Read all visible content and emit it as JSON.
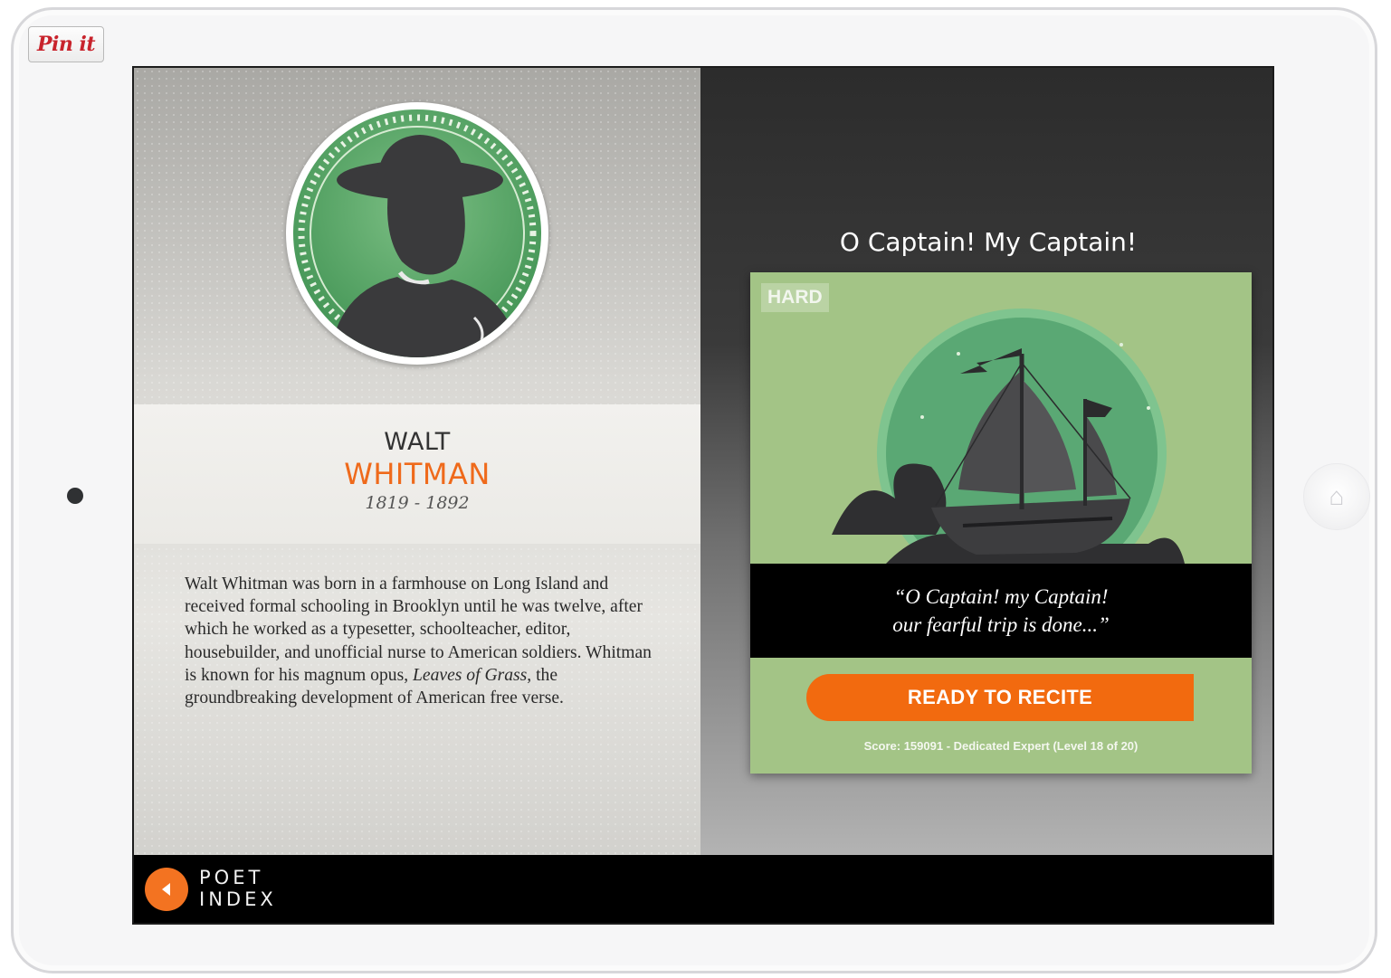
{
  "pin_button": {
    "label": "Pin it"
  },
  "poet": {
    "first_name": "WALT",
    "last_name": "WHITMAN",
    "years": "1819 - 1892",
    "bio_before": "Walt Whitman was born in a farmhouse on Long Island and received formal schooling in Brooklyn until he was twelve, after which he worked as a typesetter, schoolteacher, editor, housebuilder, and unofficial nurse to American soldiers. Whitman is known for his magnum opus, ",
    "bio_title": "Leaves of Grass",
    "bio_after": ", the groundbreaking development of American free verse."
  },
  "poem": {
    "title": "O Captain! My Captain!",
    "difficulty": "HARD",
    "quote_line1": "“O Captain! my Captain!",
    "quote_line2": "our fearful trip is done...”",
    "recite_label": "READY TO RECITE",
    "score_text": "Score: 159091 - Dedicated Expert (Level 18 of 20)"
  },
  "nav": {
    "back_line1": "POET",
    "back_line2": "INDEX"
  },
  "colors": {
    "accent_orange": "#f26a0f",
    "card_green": "#a3c486",
    "portrait_green": "#49995a"
  },
  "icons": {
    "back": "chevron-left-icon",
    "portrait": "poet-silhouette",
    "poem_art": "ship-illustration"
  }
}
